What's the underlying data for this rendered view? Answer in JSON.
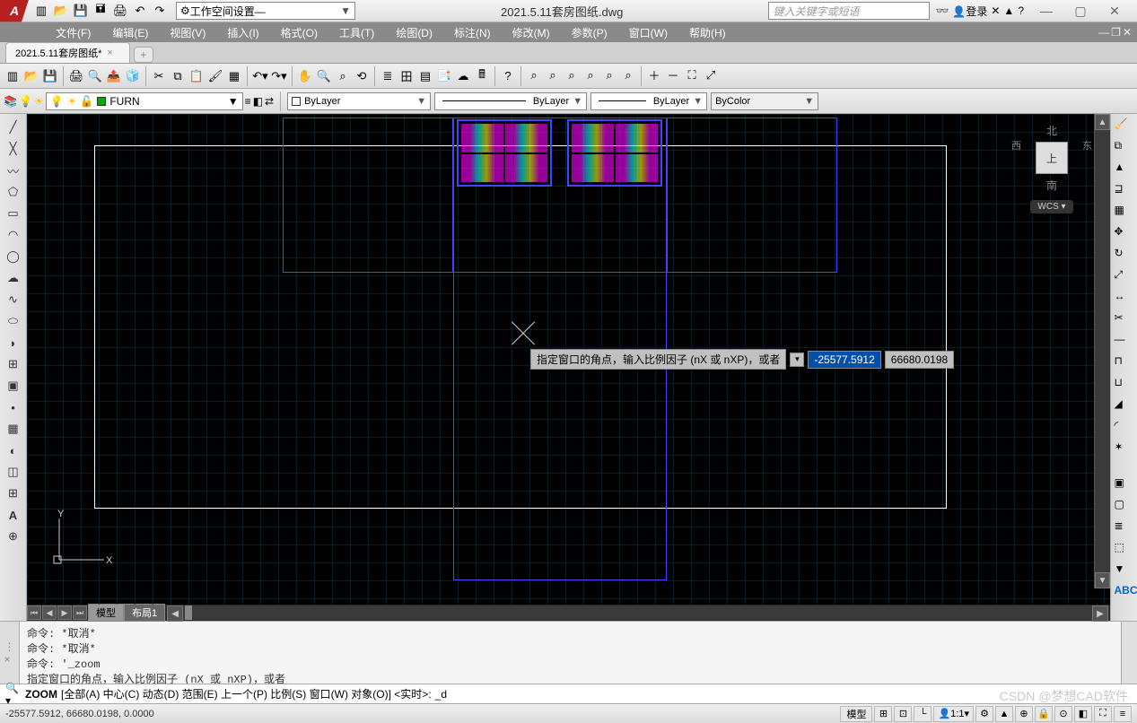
{
  "title": "2021.5.11套房图纸.dwg",
  "workspace": {
    "label": "工作空间设置—",
    "icon": "gear"
  },
  "search_placeholder": "键入关键字或短语",
  "login": "登录",
  "menus": [
    "文件(F)",
    "编辑(E)",
    "视图(V)",
    "插入(I)",
    "格式(O)",
    "工具(T)",
    "绘图(D)",
    "标注(N)",
    "修改(M)",
    "参数(P)",
    "窗口(W)",
    "帮助(H)"
  ],
  "doc_tab": "2021.5.11套房图纸*",
  "layer": {
    "name": "FURN"
  },
  "props": {
    "color": "ByLayer",
    "linetype": "ByLayer",
    "lineweight": "ByLayer",
    "plotstyle": "ByColor"
  },
  "viewcube": {
    "north": "北",
    "south": "南",
    "east": "东",
    "west": "西",
    "top": "上",
    "wcs": "WCS"
  },
  "dynamic": {
    "prompt": "指定窗口的角点，输入比例因子 (nX 或 nXP)，或者",
    "x": "-25577.5912",
    "y": "66680.0198"
  },
  "layout_tabs": {
    "model": "模型",
    "layout1": "布局1"
  },
  "cmd_history": "命令: *取消*\n命令: *取消*\n命令: '_zoom\n指定窗口的角点，输入比例因子 (nX 或 nXP)，或者",
  "cmd_line": {
    "cmd": "ZOOM",
    "options": "[全部(A) 中心(C) 动态(D) 范围(E) 上一个(P) 比例(S) 窗口(W) 对象(O)] <实时>:",
    "input": "_d"
  },
  "status": {
    "coords": "-25577.5912, 66680.0198, 0.0000",
    "model_btn": "模型",
    "scale": "1:1"
  },
  "watermark": "CSDN @梦想CAD软件"
}
